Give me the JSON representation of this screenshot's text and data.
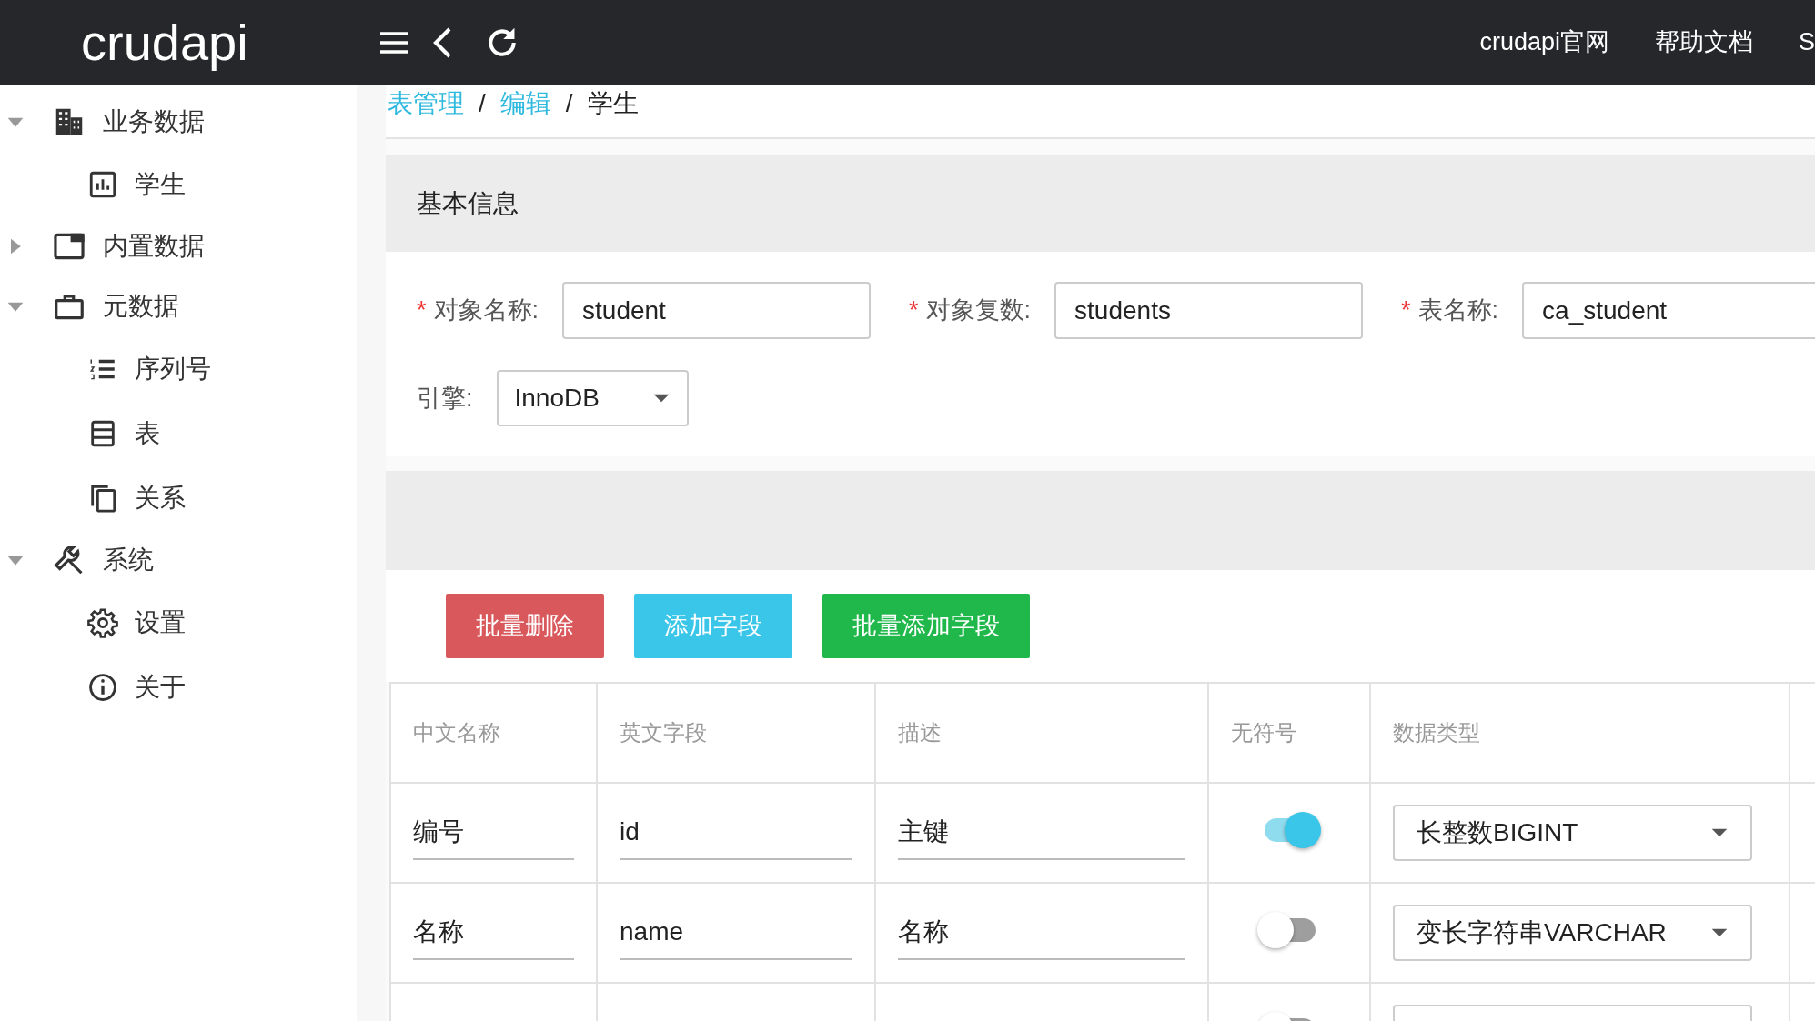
{
  "topbar": {
    "logo": "crudapi",
    "links": [
      {
        "label": "crudapi官网"
      },
      {
        "label": "帮助文档"
      },
      {
        "label": "S"
      }
    ]
  },
  "sidebar": {
    "items": [
      {
        "label": "业务数据",
        "expanded": true,
        "children": [
          {
            "label": "学生"
          }
        ]
      },
      {
        "label": "内置数据",
        "expanded": false
      },
      {
        "label": "元数据",
        "expanded": true,
        "children": [
          {
            "label": "序列号"
          },
          {
            "label": "表"
          },
          {
            "label": "关系"
          }
        ]
      },
      {
        "label": "系统",
        "expanded": true,
        "children": [
          {
            "label": "设置"
          },
          {
            "label": "关于"
          }
        ]
      }
    ]
  },
  "breadcrumb": [
    {
      "label": "表管理",
      "link": true
    },
    {
      "separator": "/",
      "label": "编辑",
      "link": true
    },
    {
      "separator": "/",
      "label": "学生",
      "link": false
    }
  ],
  "basic_info": {
    "title": "基本信息",
    "fields": [
      {
        "mark": "*",
        "label": "对象名称:",
        "kind": "input",
        "value": "student"
      },
      {
        "mark": "*",
        "label": "对象复数:",
        "kind": "input",
        "value": "students"
      },
      {
        "mark": "*",
        "label": "表名称:",
        "kind": "input",
        "value": "ca_student"
      },
      {
        "label": "引擎:",
        "kind": "select",
        "value": "InnoDB"
      }
    ]
  },
  "buttons": [
    {
      "label": "批量删除",
      "kind": "danger"
    },
    {
      "label": "添加字段",
      "kind": "info"
    },
    {
      "label": "批量添加字段",
      "kind": "success"
    }
  ],
  "table": {
    "columns": [
      "中文名称",
      "英文字段",
      "描述",
      "无符号",
      "数据类型"
    ],
    "rows": [
      {
        "name_cn": "编号",
        "name_en": "id",
        "description": "主键",
        "unsigned": true,
        "data_type": "长整数BIGINT"
      },
      {
        "name_cn": "名称",
        "name_en": "name",
        "description": "名称",
        "unsigned": false,
        "data_type": "变长字符串VARCHAR"
      },
      {
        "unsigned": false
      }
    ]
  }
}
